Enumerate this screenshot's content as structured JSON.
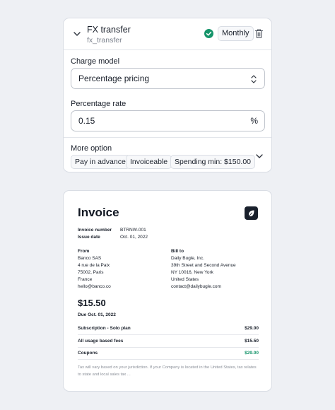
{
  "charge": {
    "title": "FX transfer",
    "code": "fx_transfer",
    "interval": "Monthly",
    "charge_model_label": "Charge model",
    "charge_model_value": "Percentage pricing",
    "percentage_rate_label": "Percentage rate",
    "percentage_rate_value": "0.15",
    "percentage_suffix": "%",
    "more_option_label": "More option",
    "options": [
      "Pay in advance",
      "Invoiceable",
      "Spending min: $150.00"
    ],
    "icons": {
      "collapse": "chevron-down-icon",
      "status": "check-circle-icon",
      "delete": "trash-icon",
      "select": "updown-arrows-icon",
      "expand": "chevron-down-icon"
    },
    "colors": {
      "success": "#15946a"
    }
  },
  "invoice": {
    "title": "Invoice",
    "number_label": "Invoice number",
    "number_value": "BTRNW-001",
    "issue_label": "Issue date",
    "issue_value": "Oct. 01, 2022",
    "from_label": "From",
    "from_lines": [
      "Banco SAS",
      "4 rue de la Paix",
      "75002, Paris",
      "France",
      "hello@banco.co"
    ],
    "bill_to_label": "Bill to",
    "bill_to_lines": [
      "Daily Bugle, Inc.",
      "39th Street and Second Avenue",
      "NY 10016, New York",
      "United States",
      "contact@dailybugle.com"
    ],
    "total": "$15.50",
    "due": "Due Oct. 01, 2022",
    "lines": [
      {
        "label": "Subscription - Solo plan",
        "amount": "$29.00"
      },
      {
        "label": "All usage based fees",
        "amount": "$15.50"
      },
      {
        "label": "Coupons",
        "amount": "$29.00"
      }
    ],
    "note": "Tax will vary based on your jurisdiction. If your Company is located in the United States, tax relates to state and local sales tax ...",
    "logo": "leaf-logo-icon"
  }
}
